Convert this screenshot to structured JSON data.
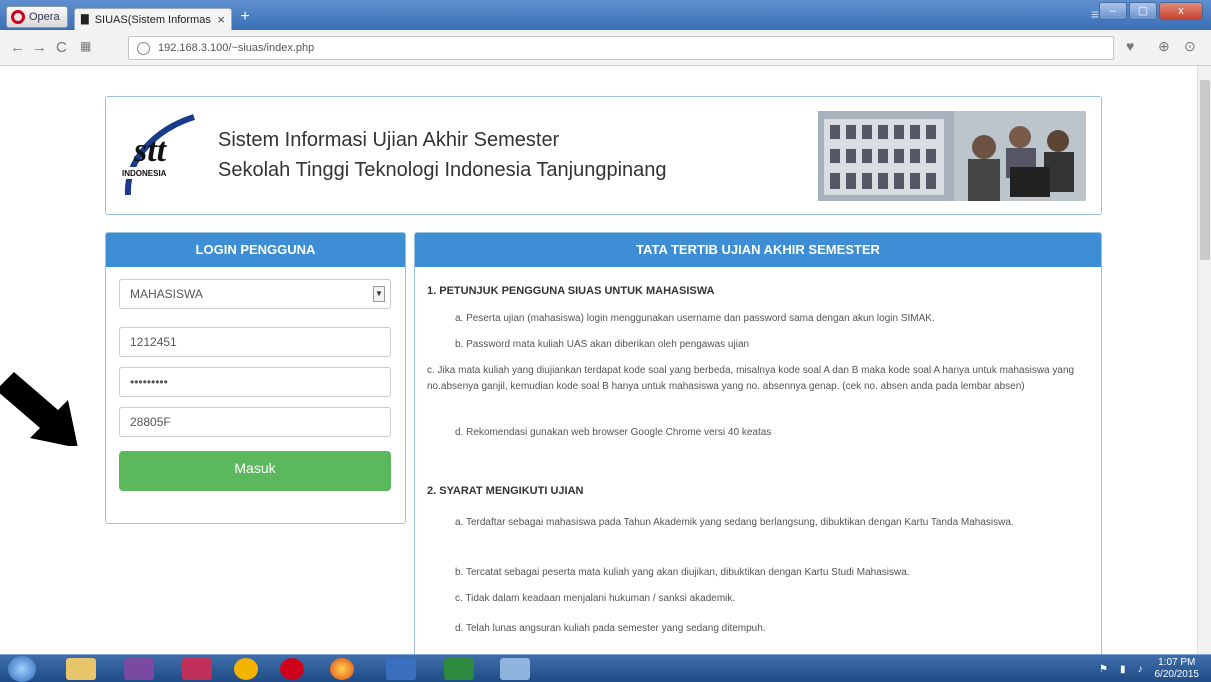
{
  "browser": {
    "opera_label": "Opera",
    "tab_title": "SIUAS(Sistem Informasi Uj",
    "tab_close": "×",
    "new_tab": "+",
    "url": "192.168.3.100/~siuas/index.php",
    "window_controls": [
      "–",
      "▢",
      "x"
    ]
  },
  "header": {
    "title_line1": "Sistem Informasi Ujian Akhir Semester",
    "title_line2": "Sekolah Tinggi Teknologi Indonesia Tanjungpinang",
    "logo_text": "stt",
    "logo_subtext": "INDONESIA"
  },
  "login": {
    "heading": "LOGIN PENGGUNA",
    "role_selected": "MAHASISWA",
    "username_value": "1212451",
    "password_value": "•••••••••",
    "captcha_value": "28805F",
    "submit_label": "Masuk"
  },
  "rules": {
    "heading": "TATA TERTIB UJIAN AKHIR SEMESTER",
    "section1_title": "1. PETUNJUK  PENGGUNA SIUAS UNTUK MAHASISWA",
    "section1_items": [
      "a.  Peserta ujian (mahasiswa) login menggunakan username dan password sama dengan akun login SIMAK.",
      "b. Password mata kuliah UAS akan diberikan oleh pengawas ujian",
      "c. Jika mata kuliah yang diujiankan terdapat kode soal yang berbeda, misalnya kode soal A dan B maka kode soal A hanya untuk mahasiswa yang no.absenya ganjil, kemudian kode soal B hanya untuk mahasiswa yang no. absennya genap. (cek no. absen anda pada lembar absen)",
      "d. Rekomendasi gunakan web browser Google Chrome versi 40 keatas"
    ],
    "section2_title": "2. SYARAT MENGIKUTI UJIAN",
    "section2_items": [
      "a. Terdaftar sebagai mahasiswa pada Tahun Akademik yang sedang berlangsung, dibuktikan dengan Kartu Tanda Mahasiswa.",
      "b. Tercatat sebagai peserta mata kuliah yang akan diujikan, dibuktikan dengan Kartu Studi Mahasiswa.",
      "c. Tidak dalam keadaan menjalani hukuman / sanksi akademik.",
      "d. Telah  lunas angsuran kuliah pada semester yang sedang  ditempuh."
    ]
  },
  "taskbar": {
    "time": "1:07 PM",
    "date": "6/20/2015"
  }
}
